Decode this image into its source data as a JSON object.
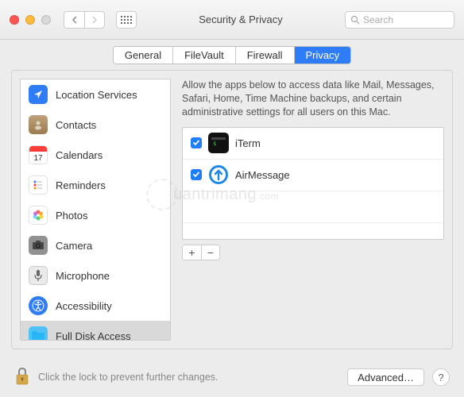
{
  "window": {
    "title": "Security & Privacy",
    "search_placeholder": "Search"
  },
  "tabs": [
    {
      "label": "General"
    },
    {
      "label": "FileVault"
    },
    {
      "label": "Firewall"
    },
    {
      "label": "Privacy"
    }
  ],
  "sidebar": {
    "items": [
      {
        "label": "Location Services",
        "icon": "location"
      },
      {
        "label": "Contacts",
        "icon": "contacts"
      },
      {
        "label": "Calendars",
        "icon": "calendar"
      },
      {
        "label": "Reminders",
        "icon": "reminders"
      },
      {
        "label": "Photos",
        "icon": "photos"
      },
      {
        "label": "Camera",
        "icon": "camera"
      },
      {
        "label": "Microphone",
        "icon": "microphone"
      },
      {
        "label": "Accessibility",
        "icon": "accessibility"
      },
      {
        "label": "Full Disk Access",
        "icon": "folder"
      }
    ],
    "selected_index": 8
  },
  "main": {
    "description": "Allow the apps below to access data like Mail, Messages, Safari, Home, Time Machine backups, and certain administrative settings for all users on this Mac.",
    "apps": [
      {
        "name": "iTerm",
        "checked": true
      },
      {
        "name": "AirMessage",
        "checked": true
      }
    ]
  },
  "calendar": {
    "day": "17"
  },
  "footer": {
    "lock_text": "Click the lock to prevent further changes.",
    "advanced_label": "Advanced…",
    "help_label": "?"
  },
  "buttons": {
    "plus": "+",
    "minus": "−"
  }
}
